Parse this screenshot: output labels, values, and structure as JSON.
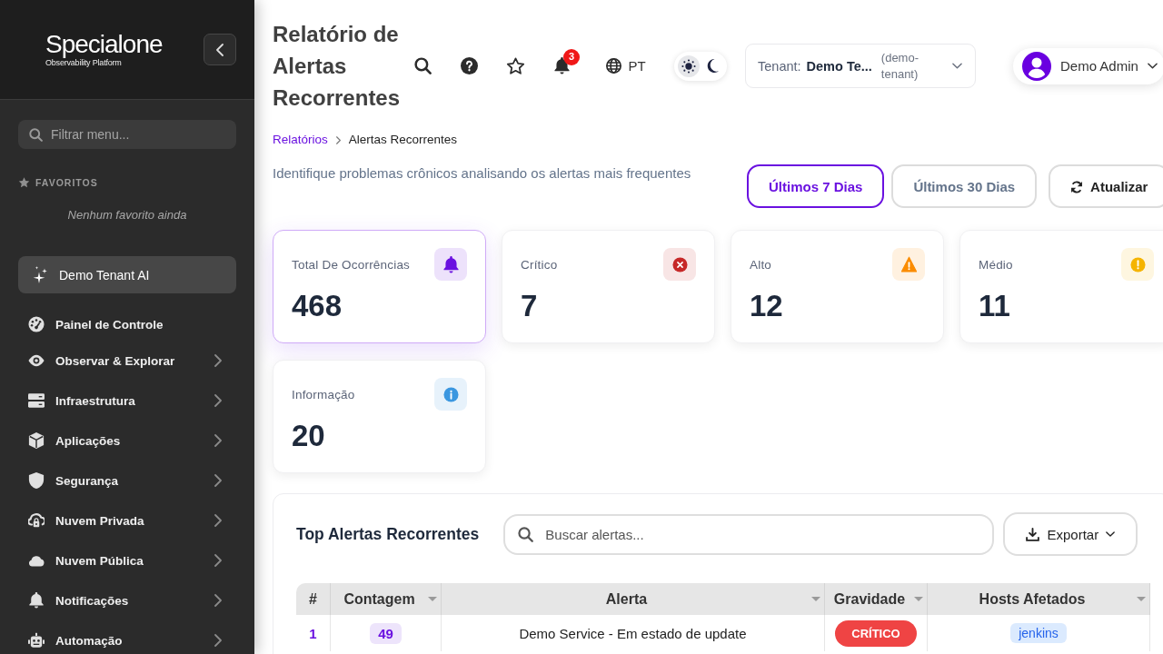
{
  "sidebar": {
    "logo": {
      "name": "Specialone",
      "tagline": "Observability Platform"
    },
    "search": {
      "placeholder": "Filtrar menu..."
    },
    "favorites": {
      "title": "FAVORITOS",
      "empty_text": "Nenhum favorito ainda"
    },
    "ai_button": {
      "label": "Demo Tenant AI"
    },
    "menu": [
      {
        "label": "Painel de Controle",
        "expandable": false
      },
      {
        "label": "Observar & Explorar",
        "expandable": true
      },
      {
        "label": "Infraestrutura",
        "expandable": true
      },
      {
        "label": "Aplicações",
        "expandable": true
      },
      {
        "label": "Segurança",
        "expandable": true
      },
      {
        "label": "Nuvem Privada",
        "expandable": true
      },
      {
        "label": "Nuvem Pública",
        "expandable": true
      },
      {
        "label": "Notificações",
        "expandable": true
      },
      {
        "label": "Automação",
        "expandable": true
      }
    ]
  },
  "header": {
    "title": "Relatório de Alertas Recorrentes",
    "notification_count": "3",
    "language": "PT",
    "dark_mode": false,
    "tenant": {
      "label": "Tenant:",
      "name": "Demo Te...",
      "slug": "(demo-tenant)"
    },
    "user": {
      "name": "Demo Admin"
    }
  },
  "breadcrumb": [
    "Relatórios",
    "Alertas Recorrentes"
  ],
  "description": "Identifique problemas crônicos analisando os alertas mais frequentes",
  "period_buttons": [
    {
      "label": "Últimos 7 Dias",
      "selected": true
    },
    {
      "label": "Últimos 30 Dias",
      "selected": false
    }
  ],
  "refresh_button": {
    "label": "Atualizar"
  },
  "summary_cards": [
    {
      "kind": "total",
      "label": "Total De Ocorrências",
      "value": "468",
      "color": "#6a11e0",
      "selected": true
    },
    {
      "kind": "critical",
      "label": "Crítico",
      "value": "7",
      "color": "#c62828",
      "selected": false
    },
    {
      "kind": "high",
      "label": "Alto",
      "value": "12",
      "color": "#fb8c00",
      "selected": false
    },
    {
      "kind": "medium",
      "label": "Médio",
      "value": "11",
      "color": "#f5b400",
      "selected": false
    },
    {
      "kind": "info",
      "label": "Informação",
      "value": "20",
      "color": "#3b97e0",
      "selected": false
    }
  ],
  "table_panel": {
    "title": "Top Alertas Recorrentes",
    "search": {
      "placeholder": "Buscar alertas..."
    },
    "export_button": {
      "label": "Exportar"
    },
    "columns": [
      {
        "label": "#",
        "sortable": false
      },
      {
        "label": "Contagem",
        "sortable": true
      },
      {
        "label": "Alerta",
        "sortable": true
      },
      {
        "label": "Gravidade",
        "sortable": true
      },
      {
        "label": "Hosts Afetados",
        "sortable": true
      }
    ],
    "rows": [
      {
        "rank": "1",
        "count": "49",
        "alert": "Demo Service - Em estado de update",
        "severity": {
          "label": "CRÍTICO",
          "kind": "critical"
        },
        "hosts": [
          "jenkins"
        ]
      }
    ]
  }
}
